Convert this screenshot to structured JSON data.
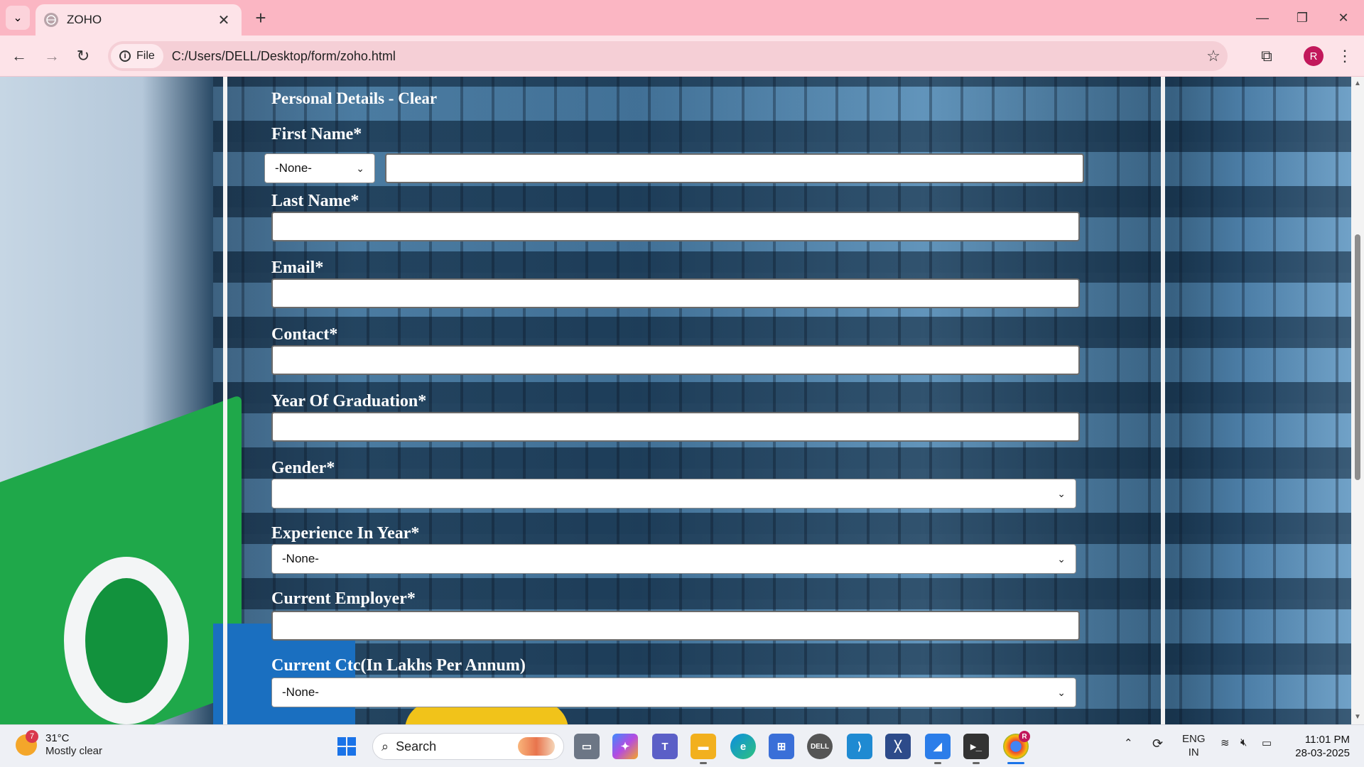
{
  "browser": {
    "tab_title": "ZOHO",
    "site_chip": "File",
    "url": "C:/Users/DELL/Desktop/form/zoho.html",
    "profile_initial": "R"
  },
  "form": {
    "section_title": "Personal Details - Clear",
    "fields": {
      "first_name_label": "First Name*",
      "salutation_value": "-None-",
      "last_name_label": "Last Name*",
      "email_label": "Email*",
      "contact_label": "Contact*",
      "graduation_label": "Year Of Graduation*",
      "gender_label": "Gender*",
      "gender_value": "",
      "experience_label": "Experience In Year*",
      "experience_value": "-None-",
      "employer_label": "Current Employer*",
      "ctc_label": "Current Ctc(In Lakhs Per Annum)",
      "ctc_value": "-None-"
    }
  },
  "taskbar": {
    "weather_badge": "7",
    "temperature": "31°C",
    "condition": "Mostly clear",
    "search_label": "Search",
    "language_line1": "ENG",
    "language_line2": "IN",
    "time": "11:01 PM",
    "date": "28-03-2025",
    "chrome_badge": "R"
  },
  "colors": {
    "tabbar": "#fbb6c3",
    "toolbar": "#fde3e8",
    "label_text": "#ffffff",
    "weather_badge": "#d9384c",
    "profile": "#c2185b"
  }
}
